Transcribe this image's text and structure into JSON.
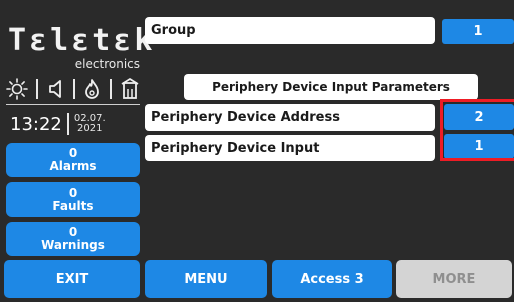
{
  "brand": {
    "name": "Tεlεtεk",
    "sub": "electronics"
  },
  "status": {
    "icons": [
      "sun-icon",
      "speaker-icon",
      "fire-icon",
      "door-icon"
    ]
  },
  "clock": {
    "time": "13:22",
    "date_line1": "02.07.",
    "date_line2": "2021"
  },
  "sidebar": {
    "alarms": {
      "count": "0",
      "label": "Alarms"
    },
    "faults": {
      "count": "0",
      "label": "Faults"
    },
    "warnings": {
      "count": "0",
      "label": "Warnings"
    }
  },
  "main": {
    "group": {
      "label": "Group",
      "value": "1"
    },
    "section_title": "Periphery Device Input Parameters",
    "address": {
      "label": "Periphery Device Address",
      "value": "2"
    },
    "input": {
      "label": "Periphery Device Input",
      "value": "1"
    }
  },
  "footer": {
    "exit": "EXIT",
    "menu": "MENU",
    "access": "Access 3",
    "more": "MORE"
  },
  "colors": {
    "accent": "#1e88e5",
    "background": "#2a2a2a",
    "highlight": "#ee1c25",
    "disabled": "#d4d4d4"
  }
}
